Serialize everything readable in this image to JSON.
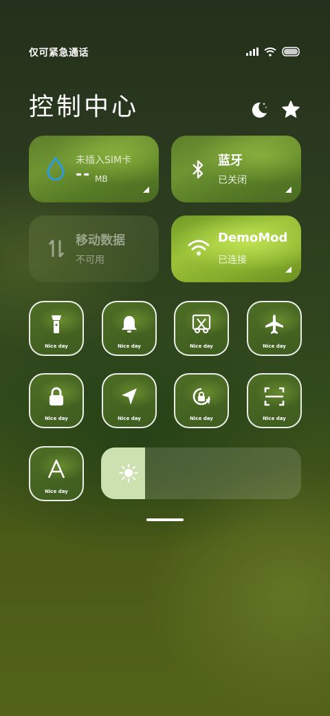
{
  "status_bar": {
    "carrier_text": "仅可紧急通话",
    "icons": [
      "signal-icon",
      "wifi-icon",
      "battery-icon"
    ]
  },
  "header": {
    "title": "控制中心",
    "icons": [
      "moon-icon",
      "star-icon"
    ]
  },
  "tiles": {
    "data_usage": {
      "title": "未插入SIM卡",
      "value": "--",
      "unit": "MB",
      "icon": "water-drop-icon"
    },
    "bluetooth": {
      "label": "蓝牙",
      "status": "已关闭",
      "icon": "bluetooth-icon"
    },
    "mobile_data": {
      "label": "移动数据",
      "status": "不可用",
      "icon": "data-arrows-icon"
    },
    "wifi": {
      "label": "DemoMod",
      "status": "已连接",
      "icon": "wifi-icon"
    }
  },
  "toggles": [
    {
      "icon": "flashlight-icon",
      "label": "Nice day"
    },
    {
      "icon": "bell-icon",
      "label": "Nice day"
    },
    {
      "icon": "screenshot-scissors-icon",
      "label": "Nice day"
    },
    {
      "icon": "airplane-icon",
      "label": "Nice day"
    },
    {
      "icon": "lock-icon",
      "label": "Nice day"
    },
    {
      "icon": "location-arrow-icon",
      "label": "Nice day"
    },
    {
      "icon": "rotation-lock-icon",
      "label": "Nice day"
    },
    {
      "icon": "scan-icon",
      "label": "Nice day"
    },
    {
      "icon": "font-icon",
      "label": "Nice day"
    }
  ],
  "brightness": {
    "level": 0.22,
    "icon": "sun-icon"
  },
  "colors": {
    "accent_blue": "#2a9be0",
    "slider_fill": "#cde0b0"
  }
}
